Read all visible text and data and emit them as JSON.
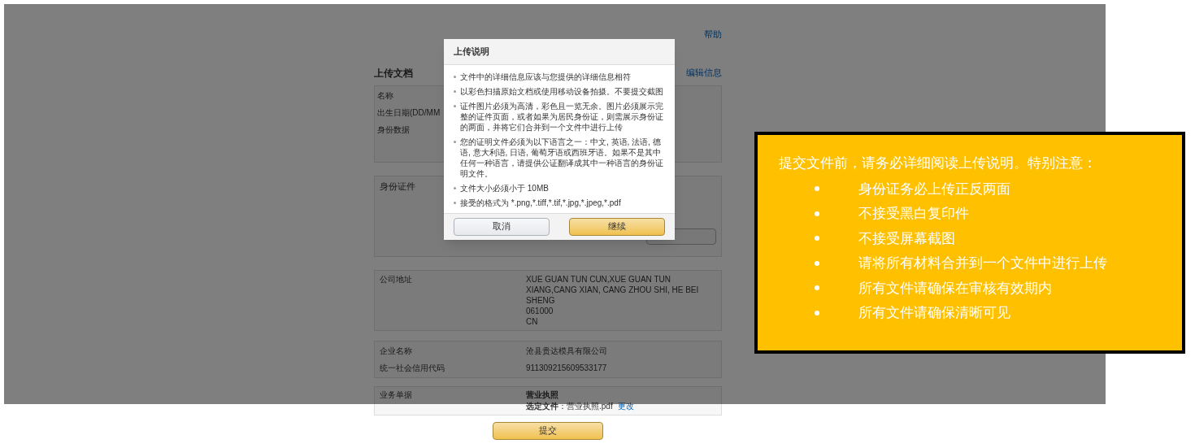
{
  "help_link": "帮助",
  "section": {
    "title": "上传文档",
    "edit_link": "编辑信息"
  },
  "identity_rows": [
    "名称",
    "出生日期(DD/MM",
    "身份数据"
  ],
  "id_document": {
    "label": "身份证件"
  },
  "address": {
    "label": "公司地址",
    "lines": [
      "XUE GUAN TUN CUN,XUE GUAN TUN",
      "XIANG,CANG XIAN, CANG ZHOU SHI, HE BEI",
      "SHENG",
      "061000",
      "CN"
    ]
  },
  "company": [
    {
      "label": "企业名称",
      "value": "沧县贵达模具有限公司"
    },
    {
      "label": "统一社会信用代码",
      "value": "911309215609533177"
    }
  ],
  "business_docs": {
    "label": "业务单据",
    "doc_title": "营业执照",
    "file_line": "**选定文件**：营业执照.pdf",
    "change_link": "更改"
  },
  "submit": "提交",
  "modal": {
    "title": "上传说明",
    "items": [
      "文件中的详细信息应该与您提供的详细信息相符",
      "以彩色扫描原始文档或使用移动设备拍摄。不要提交截图",
      "证件图片必须为高清，彩色且一览无余。图片必须展示完整的证件页面，或者如果为居民身份证，则需展示身份证的两面，并将它们合并到一个文件中进行上传",
      "您的证明文件必须为以下语言之一：中文, 英语, 法语, 德语, 意大利语, 日语, 葡萄牙语或西班牙语。如果不是其中任何一种语言，请提供公证翻译成其中一种语言的身份证明文件。",
      "文件大小必须小于 10MB",
      "接受的格式为 *.png,*.tiff,*.tif,*.jpg,*.jpeg,*.pdf"
    ],
    "buttons": [
      {
        "label": "取消",
        "kind": "secondary"
      },
      {
        "label": "继续",
        "kind": "primary"
      }
    ]
  },
  "callout": {
    "heading": "提交文件前，请务必详细阅读上传说明。特别注意：",
    "items": [
      "身份证务必上传正反两面",
      "不接受黑白复印件",
      "不接受屏幕截图",
      "请将所有材料合并到一个文件中进行上传",
      "所有文件请确保在审核有效期内",
      "所有文件请确保清晰可见"
    ]
  }
}
